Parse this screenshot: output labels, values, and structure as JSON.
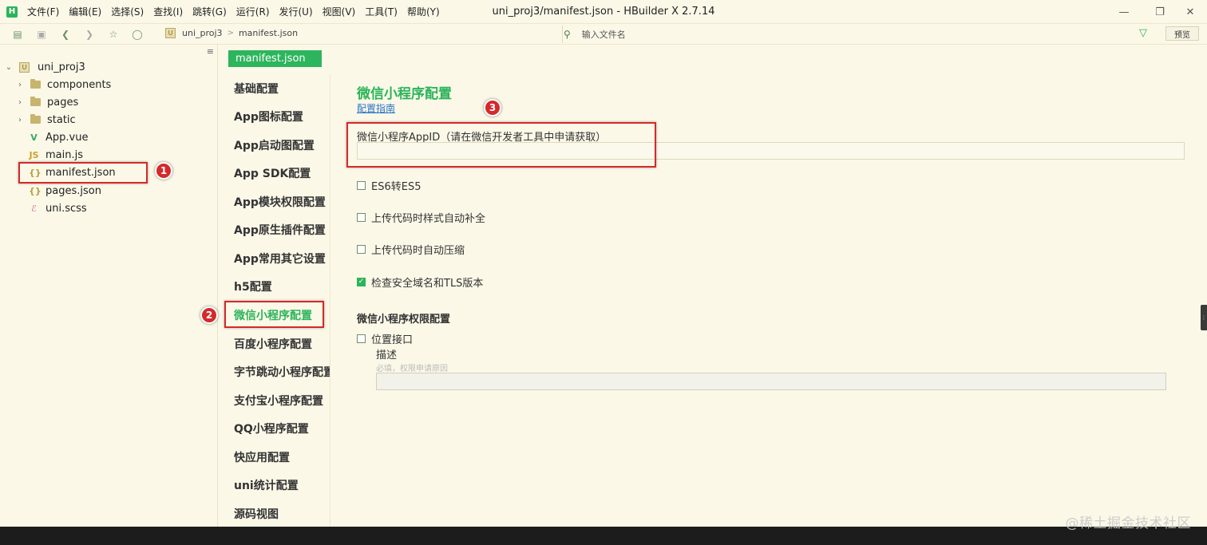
{
  "app": {
    "logo_text": "H",
    "window_title": "uni_proj3/manifest.json - HBuilder X 2.7.14"
  },
  "menu": [
    "文件(F)",
    "编辑(E)",
    "选择(S)",
    "查找(I)",
    "跳转(G)",
    "运行(R)",
    "发行(U)",
    "视图(V)",
    "工具(T)",
    "帮助(Y)"
  ],
  "toolbar": {
    "breadcrumb_project_icon": "U",
    "breadcrumb": [
      "uni_proj3",
      "manifest.json"
    ],
    "breadcrumb_sep": ">",
    "search_placeholder": "输入文件名",
    "preview_label": "预览"
  },
  "tree": {
    "collapse_glyph": "≡",
    "project_icon": "U",
    "project": "uni_proj3",
    "folders": [
      "components",
      "pages",
      "static"
    ],
    "files": [
      {
        "name": "App.vue",
        "icon_text": "V",
        "icon": "vue-icon"
      },
      {
        "name": "main.js",
        "icon_text": "JS",
        "icon": "js-icon"
      },
      {
        "name": "manifest.json",
        "icon_text": "{}",
        "icon": "json-icon"
      },
      {
        "name": "pages.json",
        "icon_text": "{}",
        "icon": "json-icon"
      },
      {
        "name": "uni.scss",
        "icon_text": "ℰ",
        "icon": "scss-icon"
      }
    ]
  },
  "editor_tab": "manifest.json",
  "config_nav": {
    "items": [
      "基础配置",
      "App图标配置",
      "App启动图配置",
      "App SDK配置",
      "App模块权限配置",
      "App原生插件配置",
      "App常用其它设置",
      "h5配置",
      "微信小程序配置",
      "百度小程序配置",
      "字节跳动小程序配置",
      "支付宝小程序配置",
      "QQ小程序配置",
      "快应用配置",
      "uni统计配置",
      "源码视图"
    ],
    "active_index": 8
  },
  "content": {
    "title": "微信小程序配置",
    "guide_link": "配置指南",
    "appid_label": "微信小程序AppID（请在微信开发者工具中申请获取）",
    "appid_value": "",
    "checkboxes": [
      {
        "label": "ES6转ES5",
        "checked": false
      },
      {
        "label": "上传代码时样式自动补全",
        "checked": false
      },
      {
        "label": "上传代码时自动压缩",
        "checked": false
      },
      {
        "label": "检查安全域名和TLS版本",
        "checked": true
      }
    ],
    "permissions_title": "微信小程序权限配置",
    "location_label": "位置接口",
    "location_checked": false,
    "desc_label": "描述",
    "desc_hint": "必填，权限申请原因",
    "desc_value": ""
  },
  "annotations": [
    "1",
    "2",
    "3"
  ],
  "watermark": "@稀土掘金技术社区",
  "colors": {
    "accent": "#2cb45a",
    "annotation": "#d42a2a",
    "background": "#fbf8e8",
    "link": "#2a73c9"
  }
}
